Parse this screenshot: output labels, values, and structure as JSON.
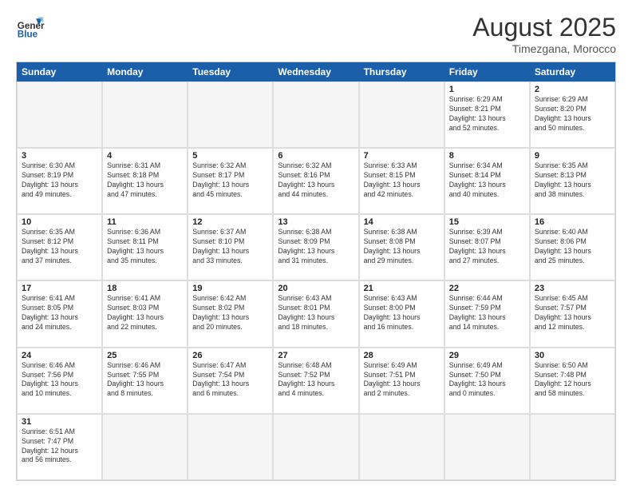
{
  "header": {
    "logo_general": "General",
    "logo_blue": "Blue",
    "month_year": "August 2025",
    "location": "Timezgana, Morocco"
  },
  "day_headers": [
    "Sunday",
    "Monday",
    "Tuesday",
    "Wednesday",
    "Thursday",
    "Friday",
    "Saturday"
  ],
  "cells": [
    {
      "day": "",
      "info": "",
      "empty": true
    },
    {
      "day": "",
      "info": "",
      "empty": true
    },
    {
      "day": "",
      "info": "",
      "empty": true
    },
    {
      "day": "",
      "info": "",
      "empty": true
    },
    {
      "day": "",
      "info": "",
      "empty": true
    },
    {
      "day": "1",
      "info": "Sunrise: 6:29 AM\nSunset: 8:21 PM\nDaylight: 13 hours\nand 52 minutes."
    },
    {
      "day": "2",
      "info": "Sunrise: 6:29 AM\nSunset: 8:20 PM\nDaylight: 13 hours\nand 50 minutes."
    },
    {
      "day": "3",
      "info": "Sunrise: 6:30 AM\nSunset: 8:19 PM\nDaylight: 13 hours\nand 49 minutes."
    },
    {
      "day": "4",
      "info": "Sunrise: 6:31 AM\nSunset: 8:18 PM\nDaylight: 13 hours\nand 47 minutes."
    },
    {
      "day": "5",
      "info": "Sunrise: 6:32 AM\nSunset: 8:17 PM\nDaylight: 13 hours\nand 45 minutes."
    },
    {
      "day": "6",
      "info": "Sunrise: 6:32 AM\nSunset: 8:16 PM\nDaylight: 13 hours\nand 44 minutes."
    },
    {
      "day": "7",
      "info": "Sunrise: 6:33 AM\nSunset: 8:15 PM\nDaylight: 13 hours\nand 42 minutes."
    },
    {
      "day": "8",
      "info": "Sunrise: 6:34 AM\nSunset: 8:14 PM\nDaylight: 13 hours\nand 40 minutes."
    },
    {
      "day": "9",
      "info": "Sunrise: 6:35 AM\nSunset: 8:13 PM\nDaylight: 13 hours\nand 38 minutes."
    },
    {
      "day": "10",
      "info": "Sunrise: 6:35 AM\nSunset: 8:12 PM\nDaylight: 13 hours\nand 37 minutes."
    },
    {
      "day": "11",
      "info": "Sunrise: 6:36 AM\nSunset: 8:11 PM\nDaylight: 13 hours\nand 35 minutes."
    },
    {
      "day": "12",
      "info": "Sunrise: 6:37 AM\nSunset: 8:10 PM\nDaylight: 13 hours\nand 33 minutes."
    },
    {
      "day": "13",
      "info": "Sunrise: 6:38 AM\nSunset: 8:09 PM\nDaylight: 13 hours\nand 31 minutes."
    },
    {
      "day": "14",
      "info": "Sunrise: 6:38 AM\nSunset: 8:08 PM\nDaylight: 13 hours\nand 29 minutes."
    },
    {
      "day": "15",
      "info": "Sunrise: 6:39 AM\nSunset: 8:07 PM\nDaylight: 13 hours\nand 27 minutes."
    },
    {
      "day": "16",
      "info": "Sunrise: 6:40 AM\nSunset: 8:06 PM\nDaylight: 13 hours\nand 25 minutes."
    },
    {
      "day": "17",
      "info": "Sunrise: 6:41 AM\nSunset: 8:05 PM\nDaylight: 13 hours\nand 24 minutes."
    },
    {
      "day": "18",
      "info": "Sunrise: 6:41 AM\nSunset: 8:03 PM\nDaylight: 13 hours\nand 22 minutes."
    },
    {
      "day": "19",
      "info": "Sunrise: 6:42 AM\nSunset: 8:02 PM\nDaylight: 13 hours\nand 20 minutes."
    },
    {
      "day": "20",
      "info": "Sunrise: 6:43 AM\nSunset: 8:01 PM\nDaylight: 13 hours\nand 18 minutes."
    },
    {
      "day": "21",
      "info": "Sunrise: 6:43 AM\nSunset: 8:00 PM\nDaylight: 13 hours\nand 16 minutes."
    },
    {
      "day": "22",
      "info": "Sunrise: 6:44 AM\nSunset: 7:59 PM\nDaylight: 13 hours\nand 14 minutes."
    },
    {
      "day": "23",
      "info": "Sunrise: 6:45 AM\nSunset: 7:57 PM\nDaylight: 13 hours\nand 12 minutes."
    },
    {
      "day": "24",
      "info": "Sunrise: 6:46 AM\nSunset: 7:56 PM\nDaylight: 13 hours\nand 10 minutes."
    },
    {
      "day": "25",
      "info": "Sunrise: 6:46 AM\nSunset: 7:55 PM\nDaylight: 13 hours\nand 8 minutes."
    },
    {
      "day": "26",
      "info": "Sunrise: 6:47 AM\nSunset: 7:54 PM\nDaylight: 13 hours\nand 6 minutes."
    },
    {
      "day": "27",
      "info": "Sunrise: 6:48 AM\nSunset: 7:52 PM\nDaylight: 13 hours\nand 4 minutes."
    },
    {
      "day": "28",
      "info": "Sunrise: 6:49 AM\nSunset: 7:51 PM\nDaylight: 13 hours\nand 2 minutes."
    },
    {
      "day": "29",
      "info": "Sunrise: 6:49 AM\nSunset: 7:50 PM\nDaylight: 13 hours\nand 0 minutes."
    },
    {
      "day": "30",
      "info": "Sunrise: 6:50 AM\nSunset: 7:48 PM\nDaylight: 12 hours\nand 58 minutes."
    },
    {
      "day": "31",
      "info": "Sunrise: 6:51 AM\nSunset: 7:47 PM\nDaylight: 12 hours\nand 56 minutes."
    },
    {
      "day": "",
      "info": "",
      "empty": true
    },
    {
      "day": "",
      "info": "",
      "empty": true
    },
    {
      "day": "",
      "info": "",
      "empty": true
    },
    {
      "day": "",
      "info": "",
      "empty": true
    },
    {
      "day": "",
      "info": "",
      "empty": true
    },
    {
      "day": "",
      "info": "",
      "empty": true
    }
  ]
}
